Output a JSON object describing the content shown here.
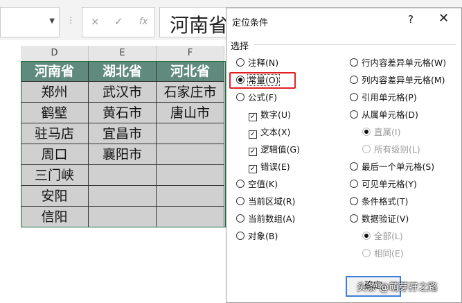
{
  "formula_bar": {
    "cancel_icon": "×",
    "enter_icon": "✓",
    "fx_label": "fx",
    "content": "河南省"
  },
  "columns": [
    "D",
    "E",
    "F"
  ],
  "table": {
    "headers": [
      "河南省",
      "湖北省",
      "河北省"
    ],
    "rows": [
      [
        "郑州",
        "武汉市",
        "石家庄市"
      ],
      [
        "鹤壁",
        "黄石市",
        "唐山市"
      ],
      [
        "驻马店",
        "宜昌市",
        ""
      ],
      [
        "周口",
        "襄阳市",
        ""
      ],
      [
        "三门峡",
        "",
        ""
      ],
      [
        "安阳",
        "",
        ""
      ],
      [
        "信阳",
        "",
        ""
      ]
    ]
  },
  "dialog": {
    "title": "定位条件",
    "help": "?",
    "close": "✕",
    "section": "选择",
    "left_options": {
      "comments": "注释(N)",
      "constants": "常量(O)",
      "formulas": "公式(F)",
      "numbers": "数字(U)",
      "text": "文本(X)",
      "logicals": "逻辑值(G)",
      "errors": "错误(E)",
      "blanks": "空值(K)",
      "current_region": "当前区域(R)",
      "current_array": "当前数组(A)",
      "objects": "对象(B)"
    },
    "right_options": {
      "row_diff": "行内容差异单元格(W)",
      "col_diff": "列内容差异单元格(M)",
      "precedents": "引用单元格(P)",
      "dependents": "从属单元格(D)",
      "direct_only": "直属(I)",
      "all_levels": "所有级别(L)",
      "last_cell": "最后一个单元格(S)",
      "visible_cells": "可见单元格(Y)",
      "conditional_formats": "条件格式(T)",
      "data_validation": "数据验证(V)",
      "all": "全部(L)",
      "same": "相同(E)"
    },
    "ok_label": "确定",
    "watermark": "头条 @萌芽孖之路"
  }
}
